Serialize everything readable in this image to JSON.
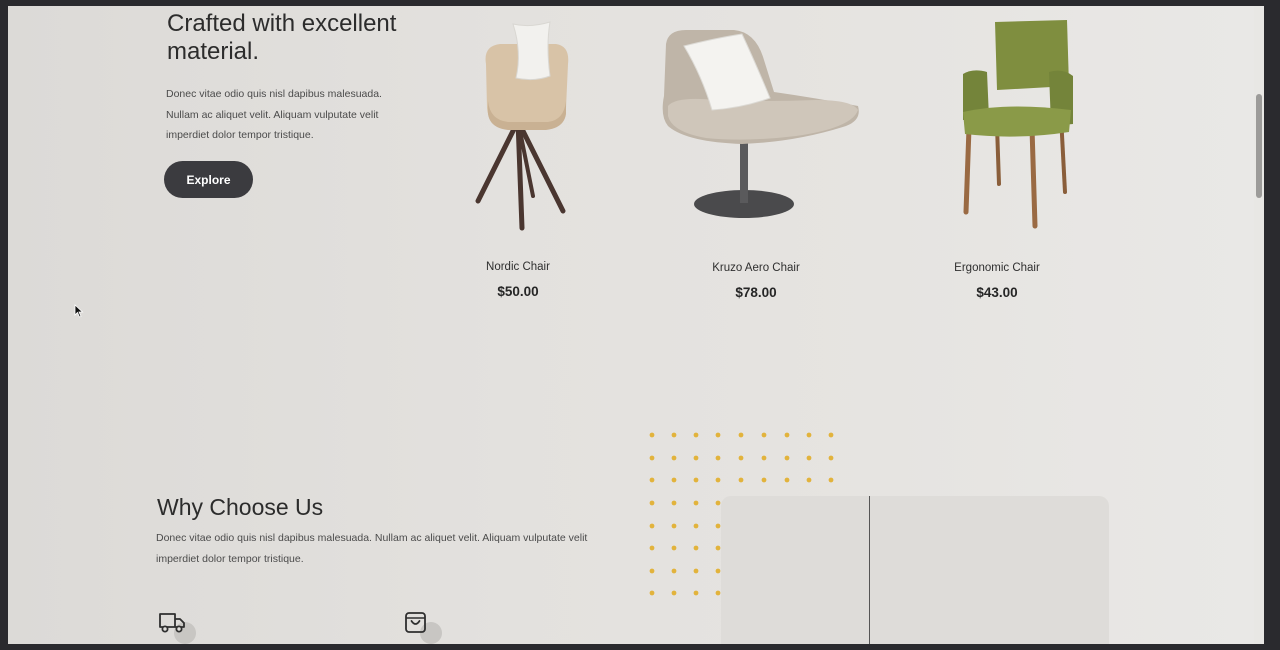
{
  "hero": {
    "title": "Crafted with excellent material.",
    "description": "Donec vitae odio quis nisl dapibus malesuada. Nullam ac aliquet velit. Aliquam vulputate velit imperdiet dolor tempor tristique.",
    "button_label": "Explore"
  },
  "products": [
    {
      "name": "Nordic Chair",
      "price": "$50.00"
    },
    {
      "name": "Kruzo Aero Chair",
      "price": "$78.00"
    },
    {
      "name": "Ergonomic Chair",
      "price": "$43.00"
    }
  ],
  "why_choose_us": {
    "title": "Why Choose Us",
    "description": "Donec vitae odio quis nisl dapibus malesuada. Nullam ac aliquet velit. Aliquam vulputate velit imperdiet dolor tempor tristique."
  },
  "features": [
    {
      "icon": "truck-icon"
    },
    {
      "icon": "shopping-bag-icon"
    }
  ],
  "colors": {
    "button_bg": "#3b3b3f",
    "dot_accent": "#e2b33c",
    "page_bg": "#e3e1de"
  }
}
